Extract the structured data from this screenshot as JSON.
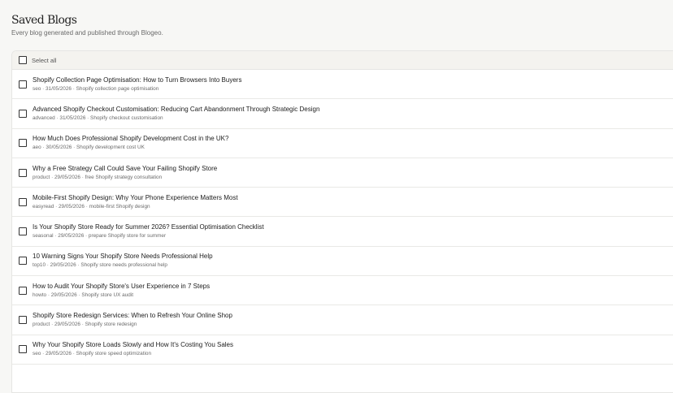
{
  "header": {
    "title": "Saved Blogs",
    "subtitle": "Every blog generated and published through Blogeo."
  },
  "list": {
    "select_all_label": "Select all",
    "items": [
      {
        "title": "Shopify Collection Page Optimisation: How to Turn Browsers Into Buyers",
        "meta": "seo · 31/05/2026 · Shopify collection page optimisation"
      },
      {
        "title": "Advanced Shopify Checkout Customisation: Reducing Cart Abandonment Through Strategic Design",
        "meta": "advanced · 31/05/2026 · Shopify checkout customisation"
      },
      {
        "title": "How Much Does Professional Shopify Development Cost in the UK?",
        "meta": "aeo · 30/05/2026 · Shopify development cost UK"
      },
      {
        "title": "Why a Free Strategy Call Could Save Your Failing Shopify Store",
        "meta": "product · 29/05/2026 · free Shopify strategy consultation"
      },
      {
        "title": "Mobile-First Shopify Design: Why Your Phone Experience Matters Most",
        "meta": "easyread · 29/05/2026 · mobile-first Shopify design"
      },
      {
        "title": "Is Your Shopify Store Ready for Summer 2026? Essential Optimisation Checklist",
        "meta": "seasonal · 29/05/2026 · prepare Shopify store for summer"
      },
      {
        "title": "10 Warning Signs Your Shopify Store Needs Professional Help",
        "meta": "top10 · 29/05/2026 · Shopify store needs professional help"
      },
      {
        "title": "How to Audit Your Shopify Store's User Experience in 7 Steps",
        "meta": "howto · 29/05/2026 · Shopify store UX audit"
      },
      {
        "title": "Shopify Store Redesign Services: When to Refresh Your Online Shop",
        "meta": "product · 29/05/2026 · Shopify store redesign"
      },
      {
        "title": "Why Your Shopify Store Loads Slowly and How It's Costing You Sales",
        "meta": "seo · 29/05/2026 · Shopify store speed optimization"
      }
    ]
  }
}
